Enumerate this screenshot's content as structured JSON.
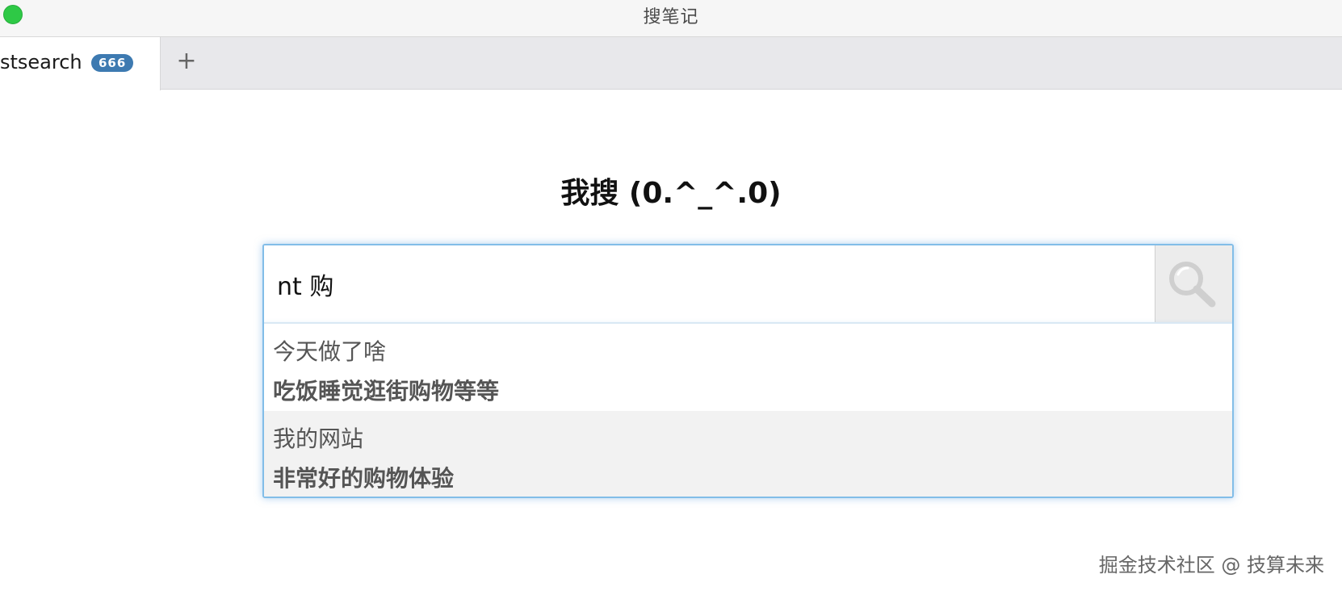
{
  "window": {
    "title": "搜笔记"
  },
  "tabs": [
    {
      "label": "stsearch",
      "badge": "666"
    }
  ],
  "new_tab_label": "+",
  "heading": "我搜 (0.^_^.0)",
  "search": {
    "value": "nt 购",
    "placeholder": ""
  },
  "suggestions": [
    {
      "title": "今天做了啥",
      "text": "吃饭睡觉逛街购物等等"
    },
    {
      "title": "我的网站",
      "text": "非常好的购物体验"
    }
  ],
  "watermark": "掘金技术社区 @ 技算未来",
  "colors": {
    "traffic_light": "#2ec946",
    "badge": "#3d7ab1",
    "focus_border": "#82bde8",
    "highlight_row": "#f2f2f2"
  },
  "icons": {
    "search_button": "magnifier-icon",
    "new_tab": "plus-icon"
  }
}
